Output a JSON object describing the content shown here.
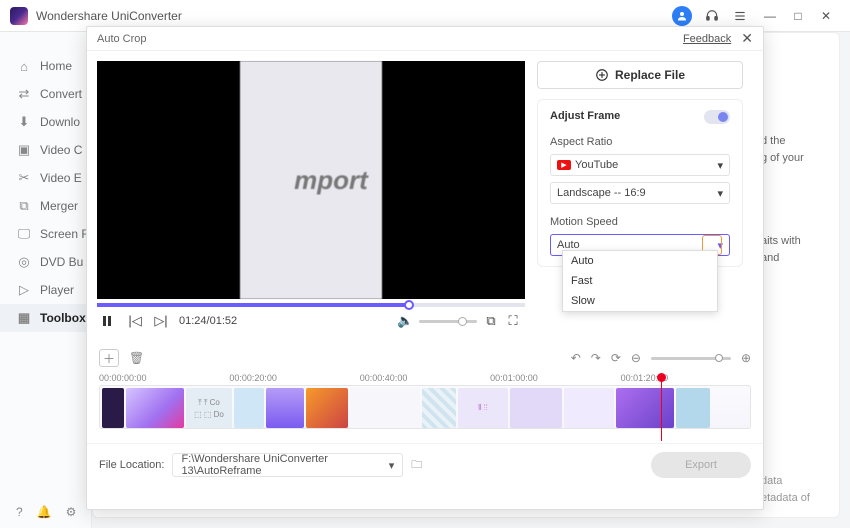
{
  "app": {
    "title": "Wondershare UniConverter"
  },
  "titlebar_icons": {
    "minimize": "—",
    "maximize": "□",
    "close": "✕"
  },
  "sidebar": {
    "items": [
      {
        "label": "Home"
      },
      {
        "label": "Convert"
      },
      {
        "label": "Downlo"
      },
      {
        "label": "Video C"
      },
      {
        "label": "Video E"
      },
      {
        "label": "Merger"
      },
      {
        "label": "Screen R"
      },
      {
        "label": "DVD Bu"
      },
      {
        "label": "Player"
      },
      {
        "label": "Toolbox"
      }
    ]
  },
  "bg_hints": {
    "h1": "d the\ng of your",
    "h2": "aits with\nand",
    "h3": "data\netadata of"
  },
  "modal": {
    "title": "Auto Crop",
    "feedback": "Feedback",
    "replace": "Replace File",
    "preview_text": "mport",
    "time": "01:24/01:52",
    "adjust_frame": "Adjust Frame",
    "aspect_ratio_label": "Aspect Ratio",
    "platform": {
      "value": "YouTube"
    },
    "ratio": {
      "value": "Landscape -- 16:9"
    },
    "motion_label": "Motion Speed",
    "motion": {
      "value": "Auto",
      "options": [
        "Auto",
        "Fast",
        "Slow"
      ]
    },
    "ticks": [
      "00:00:00:00",
      "00:00:20:00",
      "00:00:40:00",
      "00:01:00:00",
      "00:01:20:00",
      ""
    ],
    "file_location_label": "File Location:",
    "file_location": "F:\\Wondershare UniConverter 13\\AutoReframe",
    "export": "Export"
  }
}
